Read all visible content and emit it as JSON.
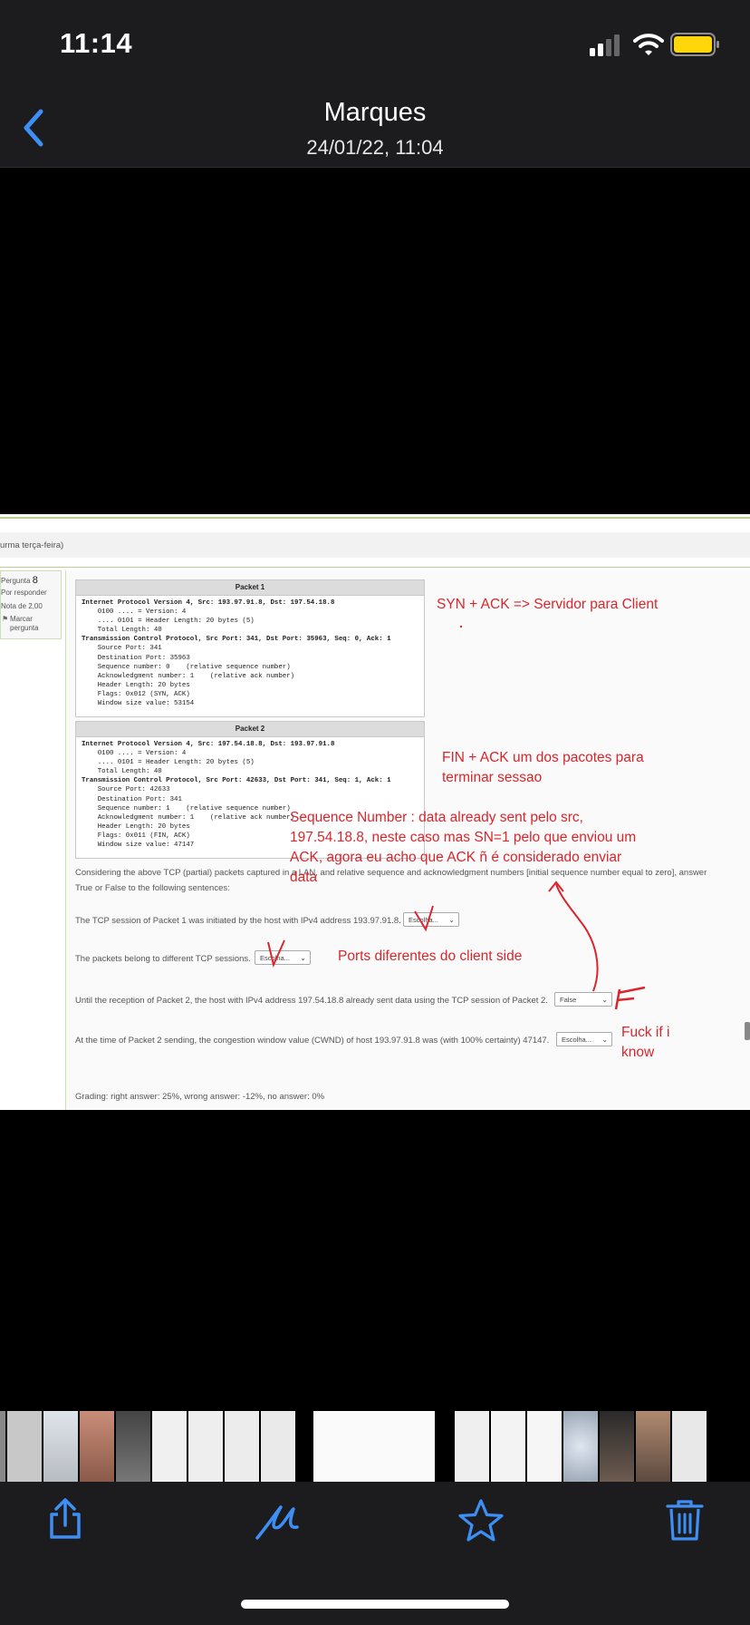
{
  "status": {
    "time": "11:14"
  },
  "nav": {
    "back_label": "",
    "title": "Marques",
    "subtitle": "24/01/22, 11:04"
  },
  "photo": {
    "course_crumb": "urma terça-feira)",
    "question_info": {
      "label": "Pergunta",
      "number": "8",
      "status": "Por responder",
      "grade": "Nota de 2,00",
      "flag": "Marcar pergunta"
    },
    "packet1": {
      "header": "Packet 1",
      "lines": [
        "Internet Protocol Version 4, Src: 193.97.91.8, Dst: 197.54.18.8",
        "    0100 .... = Version: 4",
        "    .... 0101 = Header Length: 20 bytes (5)",
        "    Total Length: 40",
        "Transmission Control Protocol, Src Port: 341, Dst Port: 35963, Seq: 0, Ack: 1",
        "    Source Port: 341",
        "    Destination Port: 35963",
        "    Sequence number: 0    (relative sequence number)",
        "    Acknowledgment number: 1    (relative ack number)",
        "    Header Length: 20 bytes",
        "    Flags: 0x012 (SYN, ACK)",
        "    Window size value: 53154"
      ]
    },
    "packet2": {
      "header": "Packet 2",
      "lines": [
        "Internet Protocol Version 4, Src: 197.54.18.8, Dst: 193.97.91.8",
        "    0100 .... = Version: 4",
        "    .... 0101 = Header Length: 20 bytes (5)",
        "    Total Length: 40",
        "Transmission Control Protocol, Src Port: 42633, Dst Port: 341, Seq: 1, Ack: 1",
        "    Source Port: 42633",
        "    Destination Port: 341",
        "    Sequence number: 1    (relative sequence number)",
        "    Acknowledgment number: 1    (relative ack number)",
        "    Header Length: 20 bytes",
        "    Flags: 0x011 (FIN, ACK)",
        "    Window size value: 47147"
      ]
    },
    "intro_line1": "Considering the above TCP (partial) packets captured in a LAN, and relative sequence and acknowledgment numbers [initial sequence number equal to zero], answer",
    "intro_line2": "True or False to the following sentences:",
    "q1": {
      "text": "The TCP session of Packet 1 was initiated by the host with IPv4 address 193.97.91.8.",
      "select": "Escolha..."
    },
    "q2": {
      "text": "The packets belong to different TCP sessions.",
      "select": "Escolha..."
    },
    "q3": {
      "text": "Until the reception of Packet 2, the host with IPv4 address 197.54.18.8 already sent data using the TCP session of Packet 2.",
      "select": "False"
    },
    "q4": {
      "text": "At the time of Packet 2 sending, the congestion window value (CWND) of host 193.97.91.8 was (with 100% certainty) 47147.",
      "select": "Escolha..."
    },
    "grading": "Grading: right answer: 25%, wrong answer: -12%, no answer: 0%",
    "notes": {
      "syn_ack": "SYN + ACK => Servidor para Client",
      "fin_ack_1": "FIN + ACK um dos pacotes para",
      "fin_ack_2": "terminar sessao",
      "seq_1": "Sequence Number : data already sent pelo src,",
      "seq_2": "197.54.18.8, neste caso mas SN=1 pelo que enviou um",
      "seq_3": "ACK, agora eu acho que ACK ñ é considerado enviar",
      "seq_4": "data",
      "ports": "Ports diferentes do client side",
      "f_mark": "F",
      "unknown_1": "Fuck if i",
      "unknown_2": "know"
    }
  },
  "toolbar": {
    "icons": [
      "share-icon",
      "markup-icon",
      "favorite-star-icon",
      "trash-icon"
    ]
  },
  "colors": {
    "accent": "#3d8ff5",
    "annotation": "#d9262c",
    "battery": "#ffd60a"
  }
}
